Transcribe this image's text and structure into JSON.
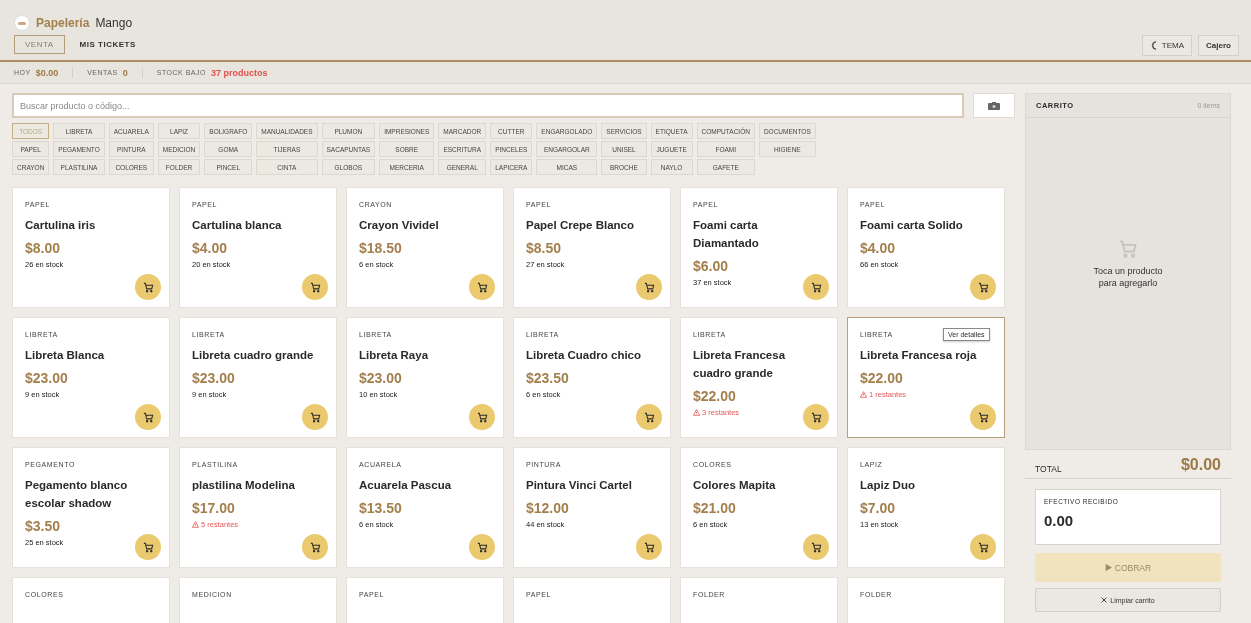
{
  "brand": {
    "name": "Papelería",
    "suffix": "Mango"
  },
  "tabs": [
    {
      "label": "VENTA",
      "selected": true
    },
    {
      "label": "MIS TICKETS",
      "selected": false
    }
  ],
  "header_buttons": {
    "theme": "TEMA",
    "user": "Cajero"
  },
  "stats": [
    {
      "label": "HOY",
      "value": "$0.00",
      "alert": false
    },
    {
      "label": "VENTAS",
      "value": "0",
      "alert": false
    },
    {
      "label": "STOCK BAJO",
      "value": "37 productos",
      "alert": true
    }
  ],
  "search": {
    "placeholder": "Buscar producto o código..."
  },
  "categories": [
    [
      {
        "label": "TODOS",
        "selected": true
      },
      {
        "label": "LIBRETA",
        "selected": false
      },
      {
        "label": "ACUARELA",
        "selected": false
      },
      {
        "label": "LAPIZ",
        "selected": false
      },
      {
        "label": "BOLIGRAFO",
        "selected": false
      },
      {
        "label": "MANUALIDADES",
        "selected": false
      },
      {
        "label": "PLUMON",
        "selected": false
      },
      {
        "label": "IMPRESIONES",
        "selected": false
      },
      {
        "label": "MARCADOR",
        "selected": false
      },
      {
        "label": "CUTTER",
        "selected": false
      },
      {
        "label": "ENGARGOLADO",
        "selected": false
      },
      {
        "label": "SERVICIOS",
        "selected": false
      },
      {
        "label": "ETIQUETA",
        "selected": false
      },
      {
        "label": "COMPUTACIÓN",
        "selected": false
      },
      {
        "label": "DOCUMENTOS",
        "selected": false
      }
    ],
    [
      {
        "label": "PAPEL",
        "selected": false
      },
      {
        "label": "PEGAMENTO",
        "selected": false
      },
      {
        "label": "PINTURA",
        "selected": false
      },
      {
        "label": "MEDICION",
        "selected": false
      },
      {
        "label": "GOMA",
        "selected": false
      },
      {
        "label": "TIJERAS",
        "selected": false
      },
      {
        "label": "SACAPUNTAS",
        "selected": false
      },
      {
        "label": "SOBRE",
        "selected": false
      },
      {
        "label": "ESCRITURA",
        "selected": false
      },
      {
        "label": "PINCELES",
        "selected": false
      },
      {
        "label": "ENGARGOLAR",
        "selected": false
      },
      {
        "label": "UNISEL",
        "selected": false
      },
      {
        "label": "JUGUETE",
        "selected": false
      },
      {
        "label": "FOAMI",
        "selected": false
      },
      {
        "label": "HIGIENE",
        "selected": false
      }
    ],
    [
      {
        "label": "CRAYON",
        "selected": false
      },
      {
        "label": "PLASTILINA",
        "selected": false
      },
      {
        "label": "COLORES",
        "selected": false
      },
      {
        "label": "FOLDER",
        "selected": false
      },
      {
        "label": "PINCEL",
        "selected": false
      },
      {
        "label": "CINTA",
        "selected": false
      },
      {
        "label": "GLOBOS",
        "selected": false
      },
      {
        "label": "MERCERIA",
        "selected": false
      },
      {
        "label": "GENERAL",
        "selected": false
      },
      {
        "label": "LAPICERA",
        "selected": false
      },
      {
        "label": "MICAS",
        "selected": false
      },
      {
        "label": "BROCHE",
        "selected": false
      },
      {
        "label": "NAYLO",
        "selected": false
      },
      {
        "label": "GAFETE",
        "selected": false
      }
    ]
  ],
  "products": [
    {
      "category": "PAPEL",
      "name": "Cartulina iris",
      "price": "$8.00",
      "stock": "26 en stock",
      "low": false,
      "hovered": false
    },
    {
      "category": "PAPEL",
      "name": "Cartulina blanca",
      "price": "$4.00",
      "stock": "20 en stock",
      "low": false,
      "hovered": false
    },
    {
      "category": "CRAYON",
      "name": "Crayon Vividel",
      "price": "$18.50",
      "stock": "6 en stock",
      "low": false,
      "hovered": false
    },
    {
      "category": "PAPEL",
      "name": "Papel Crepe Blanco",
      "price": "$8.50",
      "stock": "27 en stock",
      "low": false,
      "hovered": false
    },
    {
      "category": "PAPEL",
      "name": "Foami carta Diamantado",
      "price": "$6.00",
      "stock": "37 en stock",
      "low": false,
      "hovered": false
    },
    {
      "category": "PAPEL",
      "name": "Foami carta Solido",
      "price": "$4.00",
      "stock": "66 en stock",
      "low": false,
      "hovered": false
    },
    {
      "category": "LIBRETA",
      "name": "Libreta Blanca",
      "price": "$23.00",
      "stock": "9 en stock",
      "low": false,
      "hovered": false
    },
    {
      "category": "LIBRETA",
      "name": "Libreta cuadro grande",
      "price": "$23.00",
      "stock": "9 en stock",
      "low": false,
      "hovered": false
    },
    {
      "category": "LIBRETA",
      "name": "Libreta Raya",
      "price": "$23.00",
      "stock": "10 en stock",
      "low": false,
      "hovered": false
    },
    {
      "category": "LIBRETA",
      "name": "Libreta Cuadro chico",
      "price": "$23.50",
      "stock": "6 en stock",
      "low": false,
      "hovered": false
    },
    {
      "category": "LIBRETA",
      "name": "Libreta Francesa cuadro grande",
      "price": "$22.00",
      "stock": "3 restantes",
      "low": true,
      "hovered": false
    },
    {
      "category": "LIBRETA",
      "name": "Libreta Francesa roja",
      "price": "$22.00",
      "stock": "1 restantes",
      "low": true,
      "hovered": true,
      "tooltip": "Ver detalles"
    },
    {
      "category": "PEGAMENTO",
      "name": "Pegamento blanco escolar shadow",
      "price": "$3.50",
      "stock": "25 en stock",
      "low": false,
      "hovered": false
    },
    {
      "category": "PLASTILINA",
      "name": "plastilina Modelina",
      "price": "$17.00",
      "stock": "5 restantes",
      "low": true,
      "hovered": false
    },
    {
      "category": "ACUARELA",
      "name": "Acuarela Pascua",
      "price": "$13.50",
      "stock": "6 en stock",
      "low": false,
      "hovered": false
    },
    {
      "category": "PINTURA",
      "name": "Pintura Vinci Cartel",
      "price": "$12.00",
      "stock": "44 en stock",
      "low": false,
      "hovered": false
    },
    {
      "category": "COLORES",
      "name": "Colores Mapita",
      "price": "$21.00",
      "stock": "6 en stock",
      "low": false,
      "hovered": false
    },
    {
      "category": "LAPIZ",
      "name": "Lapiz Duo",
      "price": "$7.00",
      "stock": "13 en stock",
      "low": false,
      "hovered": false
    },
    {
      "category": "COLORES"
    },
    {
      "category": "MEDICION"
    },
    {
      "category": "PAPEL"
    },
    {
      "category": "PAPEL"
    },
    {
      "category": "FOLDER"
    },
    {
      "category": "FOLDER"
    }
  ],
  "cart": {
    "title": "CARRITO",
    "count": "0 items",
    "empty_message": "Toca un producto para agregarlo",
    "total_label": "TOTAL",
    "total": "$0.00",
    "cash_label": "EFECTIVO RECIBIDO",
    "cash_value": "0.00",
    "pay_button": {
      "label": "COBRAR",
      "disabled": true
    },
    "clear_button": "Limpiar carrito"
  }
}
